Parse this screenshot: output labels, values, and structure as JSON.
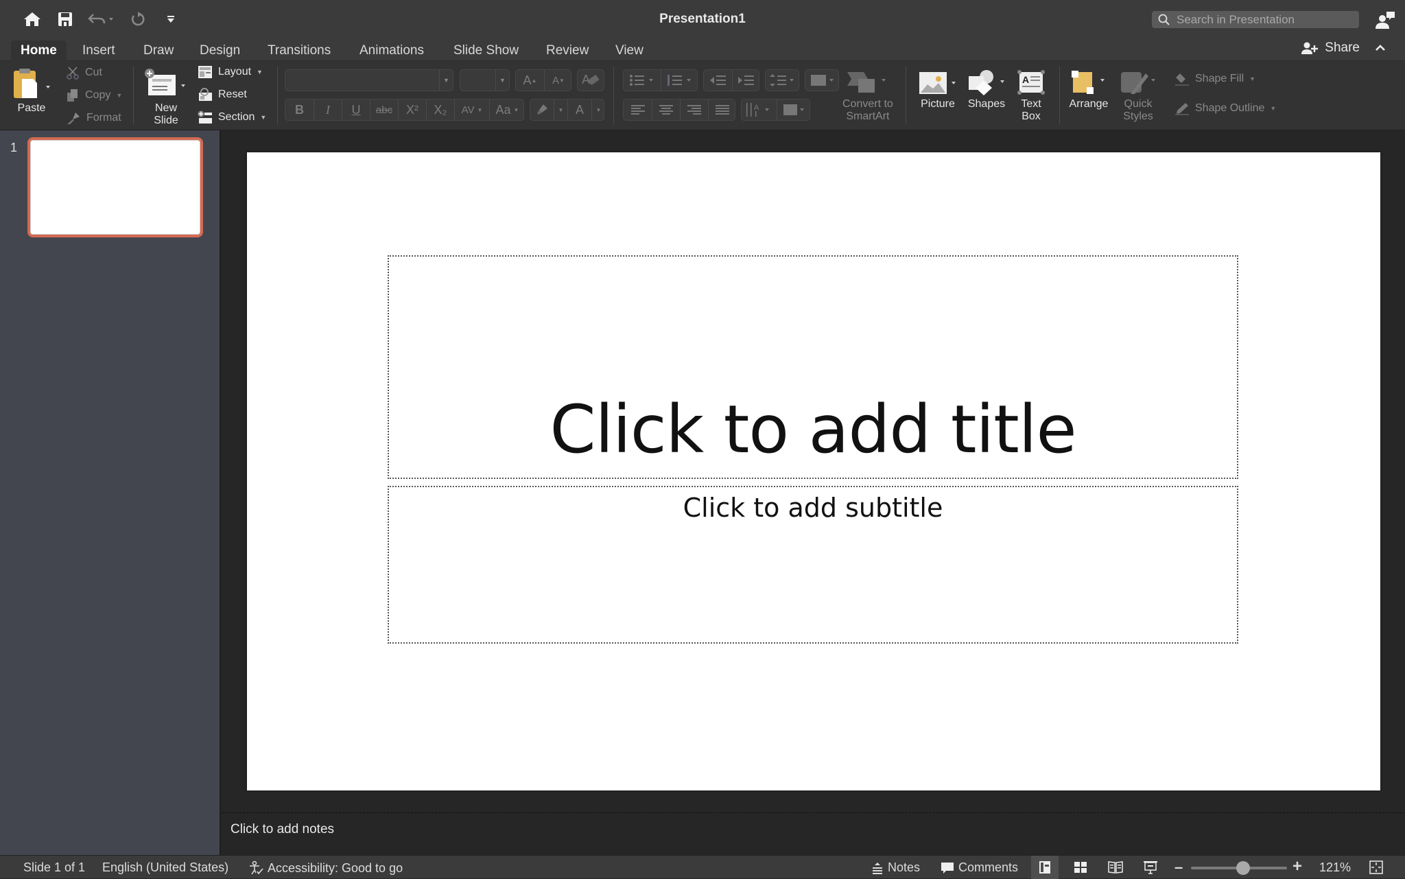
{
  "window": {
    "title": "Presentation1",
    "search_placeholder": "Search in Presentation"
  },
  "quick_access": {
    "icons": [
      "home-icon",
      "save-icon",
      "undo-icon",
      "redo-icon",
      "customize-toolbar-icon"
    ]
  },
  "tabs": [
    {
      "label": "Home",
      "active": true
    },
    {
      "label": "Insert"
    },
    {
      "label": "Draw"
    },
    {
      "label": "Design"
    },
    {
      "label": "Transitions"
    },
    {
      "label": "Animations"
    },
    {
      "label": "Slide Show"
    },
    {
      "label": "Review"
    },
    {
      "label": "View"
    }
  ],
  "share": {
    "label": "Share"
  },
  "ribbon": {
    "paste": "Paste",
    "cut": "Cut",
    "copy": "Copy",
    "format": "Format",
    "new_slide_line1": "New",
    "new_slide_line2": "Slide",
    "layout": "Layout",
    "reset": "Reset",
    "section": "Section",
    "font_name": "",
    "font_size": "",
    "bold": "B",
    "italic": "I",
    "underline": "U",
    "strikethrough": "abc",
    "superscript": "X²",
    "subscript": "X₂",
    "char_spacing": "AV",
    "change_case": "Aa",
    "font_color": "A",
    "grow_font": "A",
    "shrink_font": "A",
    "convert_smartart_line1": "Convert to",
    "convert_smartart_line2": "SmartArt",
    "picture": "Picture",
    "shapes": "Shapes",
    "text_box_line1": "Text",
    "text_box_line2": "Box",
    "arrange": "Arrange",
    "quick_styles_line1": "Quick",
    "quick_styles_line2": "Styles",
    "shape_fill": "Shape Fill",
    "shape_outline": "Shape Outline"
  },
  "slide_pane": {
    "slides": [
      {
        "number": "1",
        "selected": true
      }
    ]
  },
  "slide": {
    "title_placeholder": "Click to add title",
    "subtitle_placeholder": "Click to add subtitle"
  },
  "notes": {
    "placeholder": "Click to add notes"
  },
  "status": {
    "slide_info": "Slide 1 of 1",
    "language": "English (United States)",
    "accessibility": "Accessibility: Good to go",
    "notes": "Notes",
    "comments": "Comments",
    "zoom_level": "121%",
    "zoom_fraction": 0.55
  },
  "colors": {
    "accent_selection": "#d46a53",
    "title_bar": "#3b3b3b",
    "ribbon": "#333333",
    "slide_pane": "#43464f"
  }
}
